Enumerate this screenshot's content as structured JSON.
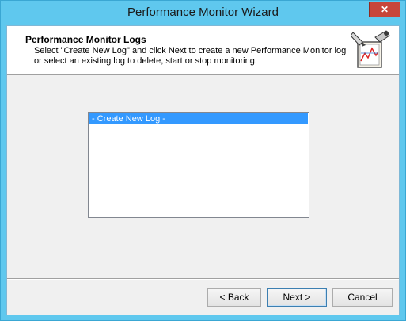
{
  "window": {
    "title": "Performance Monitor Wizard",
    "close_glyph": "✕"
  },
  "header": {
    "title": "Performance Monitor Logs",
    "description": "Select \"Create New Log\" and click Next to create a new Performance Monitor log or select an existing log to delete, start or stop monitoring.",
    "icon": "performance-monitor-wizard-icon"
  },
  "logs_list": {
    "items": [
      "- Create New Log -"
    ],
    "selected_index": 0
  },
  "buttons": {
    "back": "< Back",
    "next": "Next >",
    "cancel": "Cancel"
  },
  "colors": {
    "titlebar": "#5fc8ee",
    "selection": "#3399ff",
    "close": "#c7463a"
  }
}
